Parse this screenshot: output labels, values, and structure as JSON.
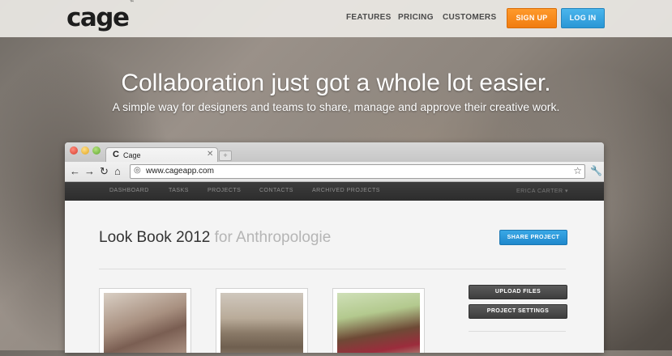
{
  "header": {
    "logo": "cage",
    "logo_mark": "™",
    "nav": [
      "FEATURES",
      "PRICING",
      "CUSTOMERS"
    ],
    "signup": "SIGN UP",
    "login": "LOG IN"
  },
  "hero": {
    "title": "Collaboration just got a whole lot easier.",
    "subtitle": "A simple way for designers and teams to share, manage and approve their creative work."
  },
  "browser": {
    "tab_title": "Cage",
    "tab_icon": "cage-favicon-icon",
    "url": "www.cageapp.com"
  },
  "app": {
    "nav": [
      "DASHBOARD",
      "TASKS",
      "PROJECTS",
      "CONTACTS",
      "ARCHIVED PROJECTS"
    ],
    "user": "ERICA CARTER ▾",
    "project_title": "Look Book 2012",
    "project_client": "for Anthropologie",
    "share_button": "SHARE PROJECT",
    "upload_button": "UPLOAD FILES",
    "settings_button": "PROJECT SETTINGS"
  },
  "colors": {
    "signup": "#f07c10",
    "login": "#2a97d6",
    "share": "#1f88cc",
    "app_nav": "#2d2d2d"
  }
}
